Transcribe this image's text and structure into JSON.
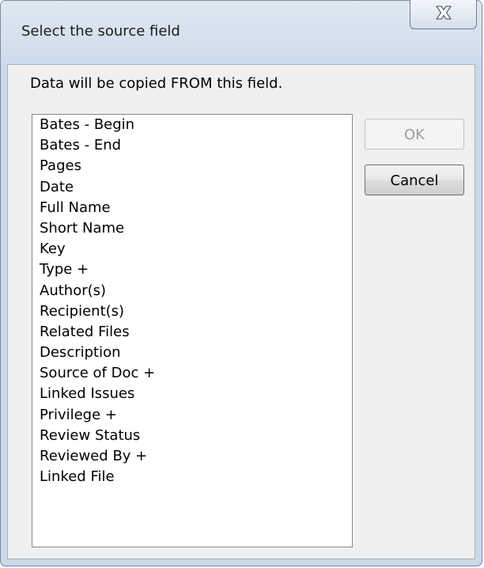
{
  "window": {
    "title": "Select the source field",
    "close_glyph": "close-icon"
  },
  "dialog": {
    "instruction": "Data will be copied FROM this field.",
    "ok_label": "OK",
    "ok_enabled": false,
    "cancel_label": "Cancel"
  },
  "fields": [
    "Bates - Begin",
    "Bates - End",
    "Pages",
    "Date",
    "Full Name",
    "Short Name",
    "Key",
    "Type +",
    "Author(s)",
    "Recipient(s)",
    "Related Files",
    "Description",
    "Source of Doc +",
    "Linked Issues",
    "Privilege +",
    "Review Status",
    "Reviewed By +",
    "Linked File"
  ]
}
